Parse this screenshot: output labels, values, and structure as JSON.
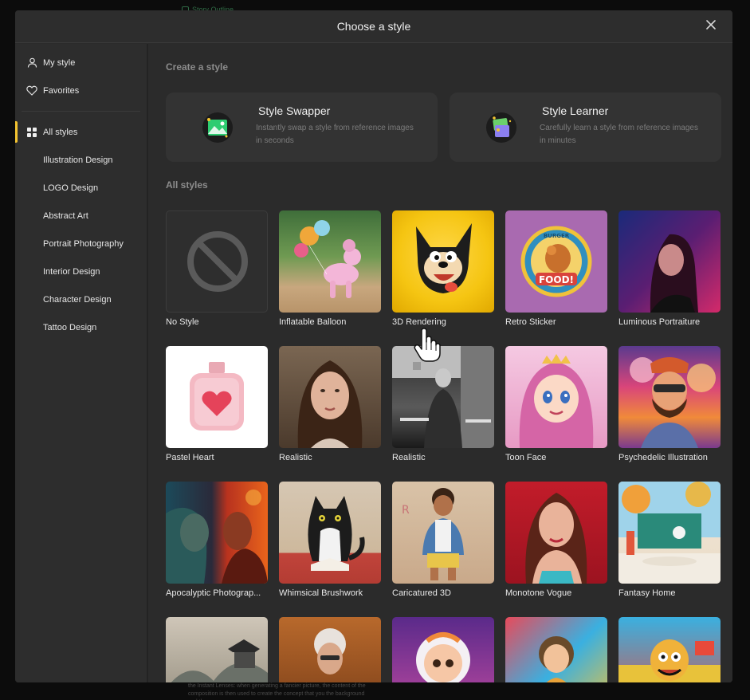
{
  "background": {
    "hint_label": "Story Outline",
    "bottom_text": "the Instant Lenses: when generating a fancier picture, the content of the composition is then used to create the concept that you the background and the ..."
  },
  "modal": {
    "title": "Choose a style",
    "close_icon": "close-icon"
  },
  "sidebar": {
    "my_style": "My style",
    "favorites": "Favorites",
    "all_styles": "All styles",
    "categories": [
      "Illustration Design",
      "LOGO Design",
      "Abstract Art",
      "Portrait Photography",
      "Interior Design",
      "Character Design",
      "Tattoo Design"
    ]
  },
  "create_section": {
    "title": "Create a style",
    "swapper": {
      "title": "Style Swapper",
      "description": "Instantly swap a style from reference images in seconds"
    },
    "learner": {
      "title": "Style Learner",
      "description": "Carefully learn a style from reference images in minutes"
    }
  },
  "styles_section": {
    "title": "All styles",
    "items": [
      {
        "label": "No Style"
      },
      {
        "label": "Inflatable Balloon"
      },
      {
        "label": "3D Rendering"
      },
      {
        "label": "Retro Sticker"
      },
      {
        "label": "Luminous Portraiture"
      },
      {
        "label": "Pastel Heart"
      },
      {
        "label": "Realistic"
      },
      {
        "label": "Realistic"
      },
      {
        "label": "Toon Face"
      },
      {
        "label": "Psychedelic Illustration"
      },
      {
        "label": "Apocalyptic Photograp..."
      },
      {
        "label": "Whimsical Brushwork"
      },
      {
        "label": "Caricatured 3D"
      },
      {
        "label": "Monotone Vogue"
      },
      {
        "label": "Fantasy Home"
      },
      {
        "label": ""
      },
      {
        "label": ""
      },
      {
        "label": ""
      },
      {
        "label": ""
      },
      {
        "label": ""
      }
    ],
    "sticker_text": "FOOD!",
    "sticker_top_text": "BURGER"
  },
  "colors": {
    "accent": "#f4c430",
    "modal_bg": "#2b2b2b",
    "card_bg": "#333333"
  }
}
